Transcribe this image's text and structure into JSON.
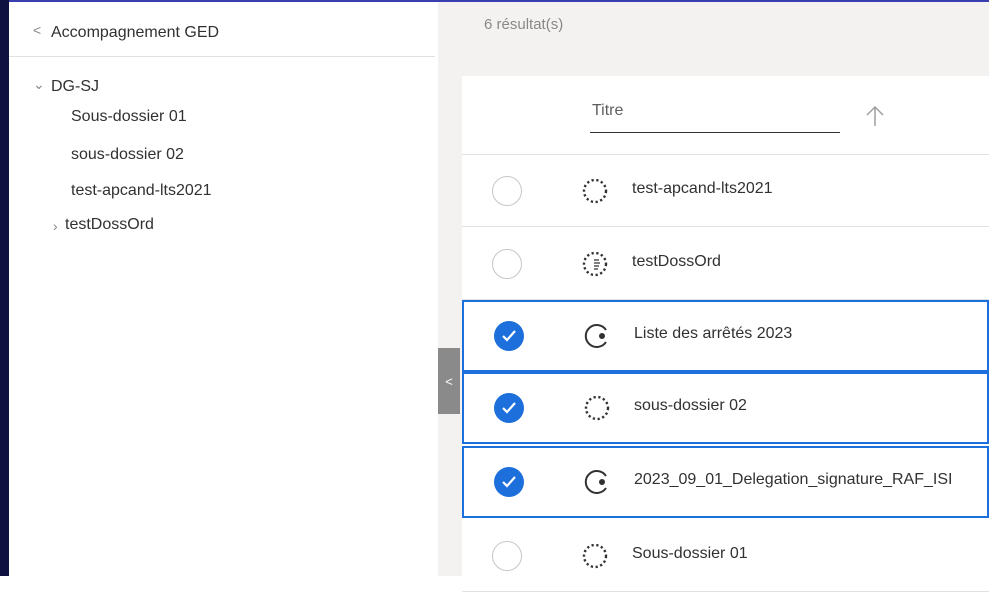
{
  "sidebar": {
    "back_glyph": "<",
    "title": "Accompagnement GED",
    "tree": {
      "root_label": "DG-SJ",
      "children": [
        "Sous-dossier 01",
        "sous-dossier 02",
        "test-apcand-lts2021"
      ],
      "collapsed_child": "testDossOrd"
    }
  },
  "collapse_handle_glyph": "<",
  "results": {
    "count_text": "6 résultat(s)",
    "column_title": "Titre",
    "sort_icon": "arrow-up-icon",
    "rows": [
      {
        "name": "test-apcand-lts2021",
        "selected": false,
        "icon": "dotted-circle-icon"
      },
      {
        "name": "testDossOrd",
        "selected": false,
        "icon": "dotted-circle-lines-icon"
      },
      {
        "name": "Liste des arrêtés 2023",
        "selected": true,
        "icon": "open-circle-dot-icon"
      },
      {
        "name": "sous-dossier 02",
        "selected": true,
        "icon": "dotted-circle-icon"
      },
      {
        "name": "2023_09_01_Delegation_signature_RAF_ISI",
        "selected": true,
        "icon": "open-circle-dot-icon"
      },
      {
        "name": "Sous-dossier 01",
        "selected": false,
        "icon": "dotted-circle-icon"
      }
    ]
  },
  "colors": {
    "accent": "#1d6fdc",
    "left_bar": "#0f1140",
    "main_bg": "#f3f2f1"
  }
}
